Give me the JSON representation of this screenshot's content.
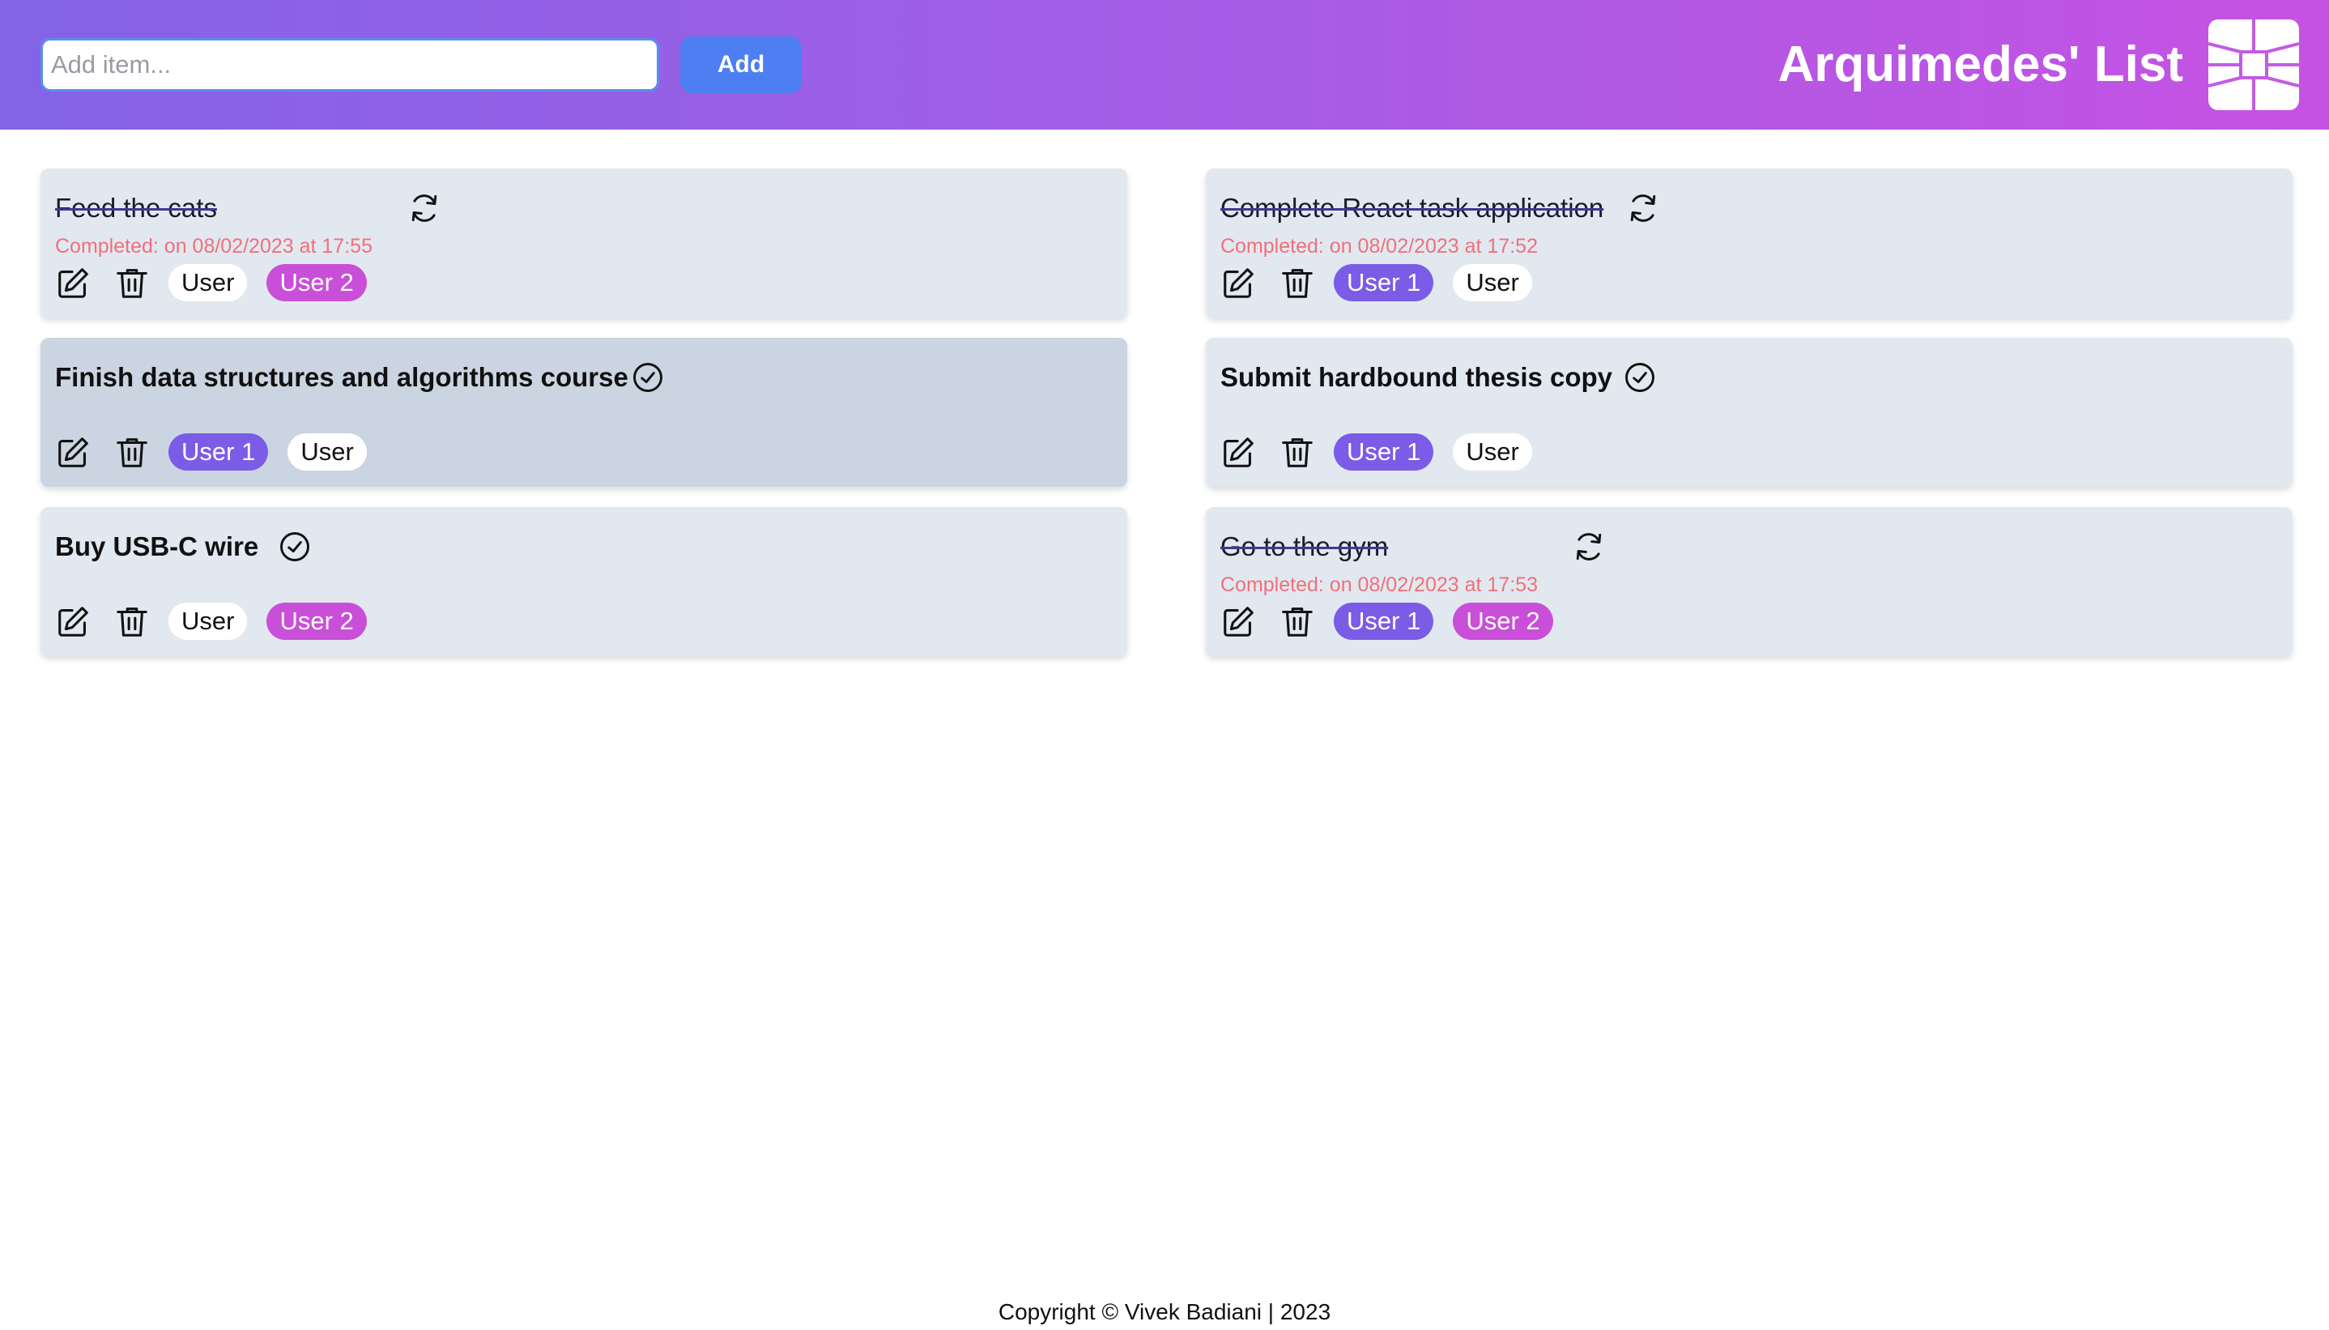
{
  "header": {
    "input_placeholder": "Add item...",
    "input_value": "",
    "add_label": "Add",
    "title": "Arquimedes' List",
    "gradient_start": "#8363e6",
    "gradient_end": "#c652e3"
  },
  "icons": {
    "edit": "pencil-square-icon",
    "delete": "trash-icon",
    "complete": "check-circle-icon",
    "reopen": "refresh-arrows-icon",
    "logo": "logo-grid-icon"
  },
  "colors": {
    "card_bg": "#e2e8f0",
    "card_hover_bg": "#cbd5e1",
    "completed_text": "#f0707a",
    "user1_tag": "#7b5ce6",
    "user2_tag": "#c94fd8",
    "add_button": "#4d7ff2"
  },
  "tasks_left": [
    {
      "title": "Feed the cats",
      "completed": "Completed: on 08/02/2023 at 17:55",
      "tags": [
        "User",
        "User 2"
      ]
    },
    {
      "title": "Finish data structures and algorithms course",
      "tags": [
        "User 1",
        "User"
      ]
    },
    {
      "title": "Buy USB-C wire",
      "tags": [
        "User",
        "User 2"
      ]
    }
  ],
  "tasks_right": [
    {
      "title": "Complete React task application",
      "completed": "Completed: on 08/02/2023 at 17:52",
      "tags": [
        "User 1",
        "User"
      ]
    },
    {
      "title": "Submit hardbound thesis copy",
      "tags": [
        "User 1",
        "User"
      ]
    },
    {
      "title": "Go to the gym",
      "completed": "Completed: on 08/02/2023 at 17:53",
      "tags": [
        "User 1",
        "User 2"
      ]
    }
  ],
  "footer": {
    "text": "Copyright © Vivek Badiani | 2023"
  }
}
